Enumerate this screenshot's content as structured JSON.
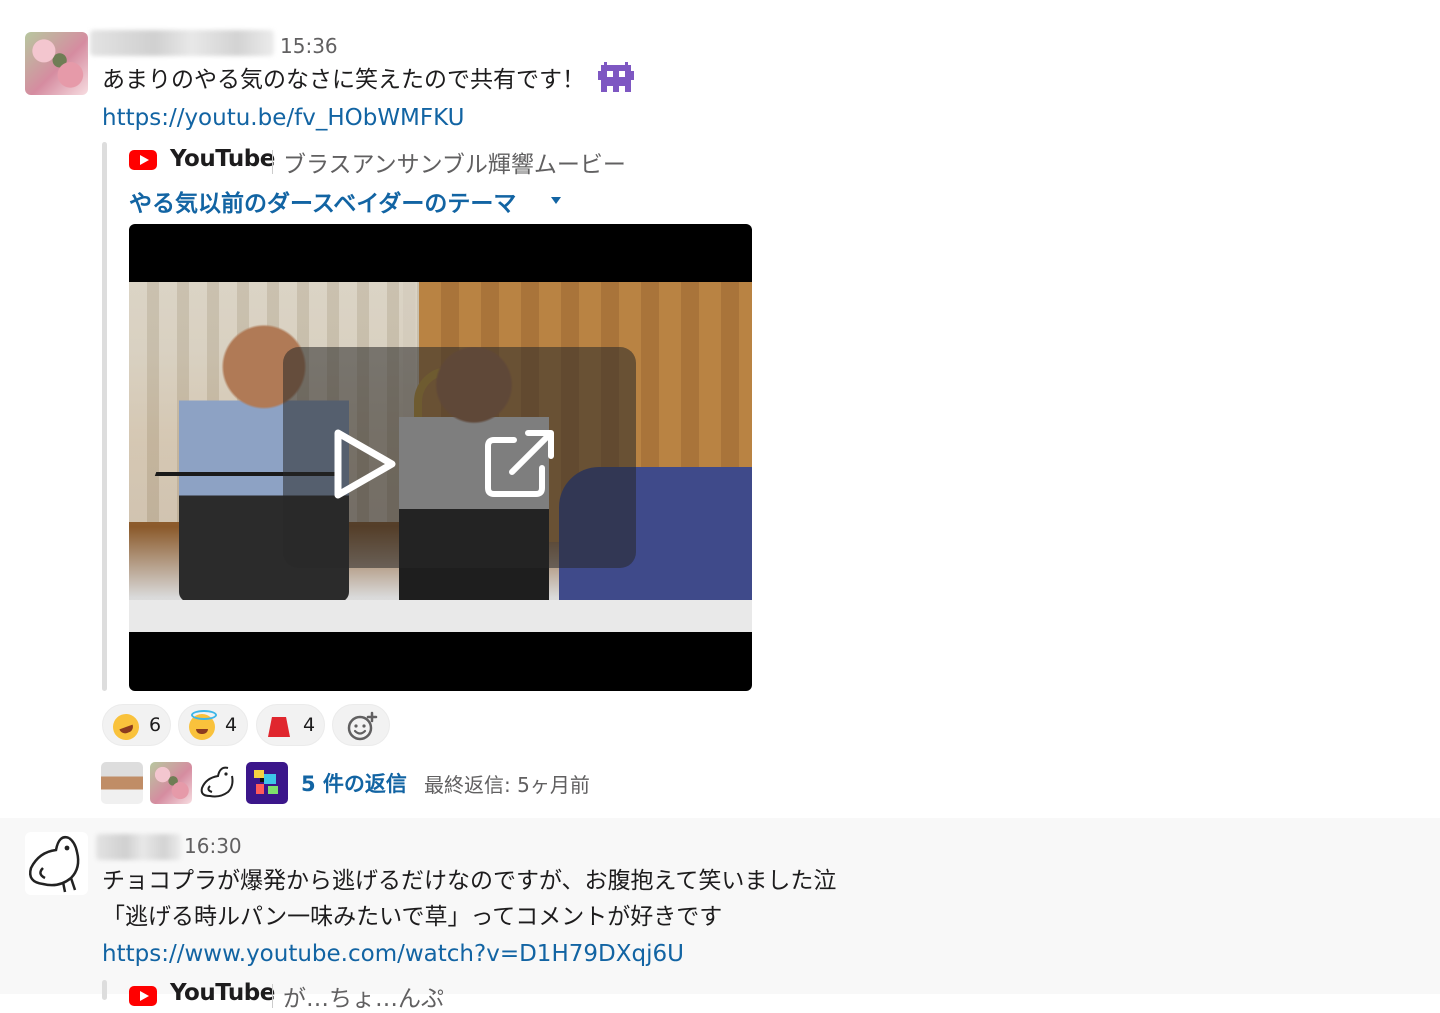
{
  "messages": [
    {
      "time": "15:36",
      "lines": [
        "あまりのやる気のなさに笑えたので共有です！"
      ],
      "link": "https://youtu.be/fv_HObWMFKU",
      "attachment": {
        "service": "YouTube",
        "channel": "ブラスアンサンブル輝響ムービー",
        "title": "やる気以前のダースベイダーのテーマ"
      },
      "reactions": [
        {
          "emoji": "rolling-on-floor-laughing-icon",
          "count": "6"
        },
        {
          "emoji": "smiling-face-with-halo-icon",
          "count": "4"
        },
        {
          "emoji": "fez-hat-icon",
          "count": "4"
        }
      ],
      "replies": {
        "count_label": "5 件の返信",
        "last_reply": "最終返信: 5ヶ月前"
      }
    },
    {
      "time": "16:30",
      "lines": [
        "チョコプラが爆発から逃げるだけなのですが、お腹抱えて笑いました泣",
        "「逃げる時ルパン一味みたいで草」ってコメントが好きです"
      ],
      "link": "https://www.youtube.com/watch?v=D1H79DXqj6U",
      "attachment": {
        "service": "YouTube",
        "channel": "が…ちょ…んぷ"
      }
    }
  ],
  "colors": {
    "link": "#1264a3",
    "muted": "#616061",
    "youtube_red": "#ff0000",
    "hover_background": "#f8f8f8"
  }
}
